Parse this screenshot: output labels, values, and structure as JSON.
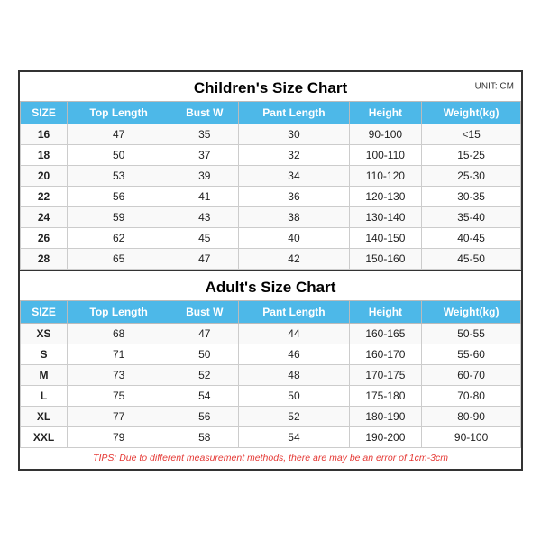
{
  "children_title": "Children's Size Chart",
  "adult_title": "Adult's Size Chart",
  "unit": "UNIT: CM",
  "headers": [
    "SIZE",
    "Top Length",
    "Bust W",
    "Pant Length",
    "Height",
    "Weight(kg)"
  ],
  "children_rows": [
    {
      "size": "16",
      "top_length": "47",
      "bust_w": "35",
      "pant_length": "30",
      "height": "90-100",
      "weight": "<15"
    },
    {
      "size": "18",
      "top_length": "50",
      "bust_w": "37",
      "pant_length": "32",
      "height": "100-110",
      "weight": "15-25"
    },
    {
      "size": "20",
      "top_length": "53",
      "bust_w": "39",
      "pant_length": "34",
      "height": "110-120",
      "weight": "25-30"
    },
    {
      "size": "22",
      "top_length": "56",
      "bust_w": "41",
      "pant_length": "36",
      "height": "120-130",
      "weight": "30-35"
    },
    {
      "size": "24",
      "top_length": "59",
      "bust_w": "43",
      "pant_length": "38",
      "height": "130-140",
      "weight": "35-40"
    },
    {
      "size": "26",
      "top_length": "62",
      "bust_w": "45",
      "pant_length": "40",
      "height": "140-150",
      "weight": "40-45"
    },
    {
      "size": "28",
      "top_length": "65",
      "bust_w": "47",
      "pant_length": "42",
      "height": "150-160",
      "weight": "45-50"
    }
  ],
  "adult_rows": [
    {
      "size": "XS",
      "top_length": "68",
      "bust_w": "47",
      "pant_length": "44",
      "height": "160-165",
      "weight": "50-55"
    },
    {
      "size": "S",
      "top_length": "71",
      "bust_w": "50",
      "pant_length": "46",
      "height": "160-170",
      "weight": "55-60"
    },
    {
      "size": "M",
      "top_length": "73",
      "bust_w": "52",
      "pant_length": "48",
      "height": "170-175",
      "weight": "60-70"
    },
    {
      "size": "L",
      "top_length": "75",
      "bust_w": "54",
      "pant_length": "50",
      "height": "175-180",
      "weight": "70-80"
    },
    {
      "size": "XL",
      "top_length": "77",
      "bust_w": "56",
      "pant_length": "52",
      "height": "180-190",
      "weight": "80-90"
    },
    {
      "size": "XXL",
      "top_length": "79",
      "bust_w": "58",
      "pant_length": "54",
      "height": "190-200",
      "weight": "90-100"
    }
  ],
  "tips": "TIPS: Due to different measurement methods, there are may be an error of 1cm-3cm"
}
